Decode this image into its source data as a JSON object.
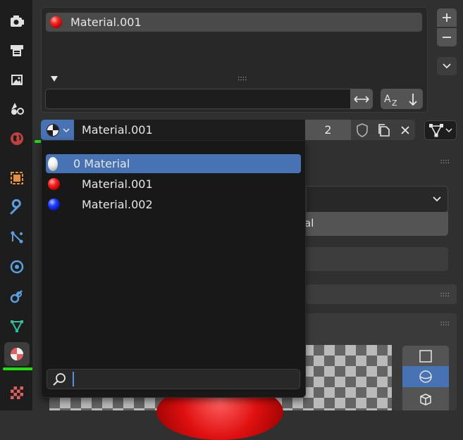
{
  "colors": {
    "accent": "#4772b3",
    "highlight_marker": "#22dd11",
    "material_red": "#ff2020",
    "material_blue": "#2040ff"
  },
  "tabs": [
    {
      "name": "tool-icon",
      "active": false
    },
    {
      "name": "render-icon",
      "active": false
    },
    {
      "name": "output-icon",
      "active": false
    },
    {
      "name": "view-layer-icon",
      "active": false
    },
    {
      "name": "scene-icon",
      "active": false
    },
    {
      "name": "world-icon",
      "active": false
    },
    {
      "name": "object-icon",
      "active": false
    },
    {
      "name": "modifier-wrench-icon",
      "active": false
    },
    {
      "name": "particles-icon",
      "active": false
    },
    {
      "name": "physics-icon",
      "active": false
    },
    {
      "name": "constraints-icon",
      "active": false
    },
    {
      "name": "object-data-mesh-icon",
      "active": false
    },
    {
      "name": "material-icon",
      "active": true
    },
    {
      "name": "texture-checker-icon",
      "active": false
    }
  ],
  "material_slots": {
    "items": [
      {
        "label": "Material.001",
        "color": "red"
      }
    ],
    "grip": "::::"
  },
  "datablock": {
    "name": "Material.001",
    "users": "2"
  },
  "dropdown": {
    "items": [
      {
        "label": "0 Material",
        "color": "white",
        "selected": true
      },
      {
        "label": "Material.001",
        "color": "red",
        "selected": false
      },
      {
        "label": "Material.002",
        "color": "blue",
        "selected": false
      }
    ],
    "search_value": ""
  },
  "background": {
    "partial_text": "al",
    "grip": "::::"
  }
}
